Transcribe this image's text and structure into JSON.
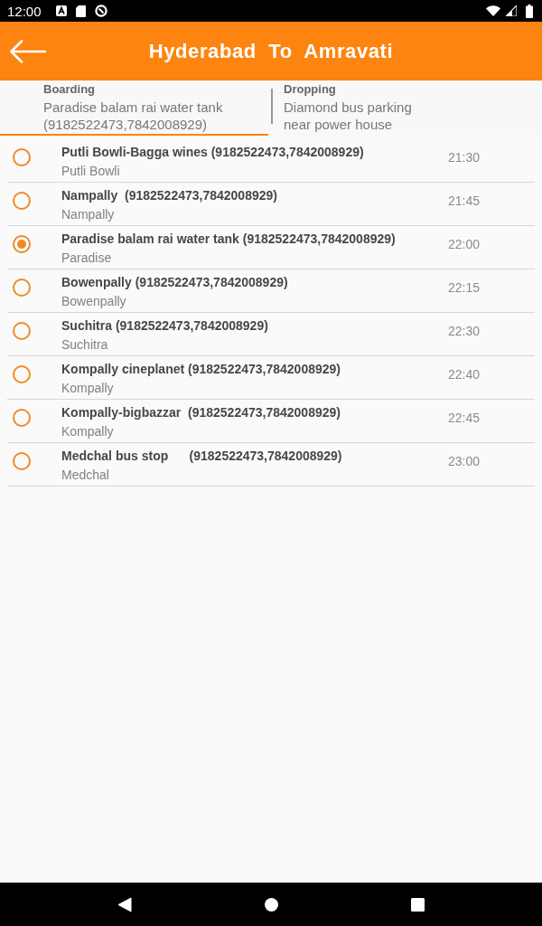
{
  "status_bar": {
    "time": "12:00"
  },
  "toolbar": {
    "title": "Hyderabad  To  Amravati"
  },
  "tabs": [
    {
      "label": "Boarding",
      "value": "Paradise balam rai water tank (9182522473,7842008929)",
      "selected": true
    },
    {
      "label": "Dropping",
      "value": "Diamond bus parking near power house",
      "selected": false
    }
  ],
  "stops": [
    {
      "name": "Putli Bowli-Bagga wines (9182522473,7842008929)",
      "area": "Putli Bowli",
      "time": "21:30",
      "selected": false
    },
    {
      "name": "Nampally  (9182522473,7842008929)",
      "area": "Nampally",
      "time": "21:45",
      "selected": false
    },
    {
      "name": "Paradise balam rai water tank (9182522473,7842008929)",
      "area": "Paradise",
      "time": "22:00",
      "selected": true
    },
    {
      "name": "Bowenpally (9182522473,7842008929)",
      "area": "Bowenpally",
      "time": "22:15",
      "selected": false
    },
    {
      "name": "Suchitra (9182522473,7842008929)",
      "area": "Suchitra",
      "time": "22:30",
      "selected": false
    },
    {
      "name": "Kompally cineplanet (9182522473,7842008929)",
      "area": "Kompally",
      "time": "22:40",
      "selected": false
    },
    {
      "name": "Kompally-bigbazzar  (9182522473,7842008929)",
      "area": "Kompally",
      "time": "22:45",
      "selected": false
    },
    {
      "name": "Medchal bus stop      (9182522473,7842008929)",
      "area": "Medchal",
      "time": "23:00",
      "selected": false
    }
  ]
}
